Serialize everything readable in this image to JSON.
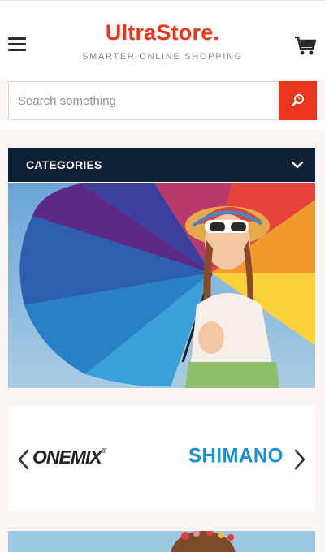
{
  "header": {
    "logo": "UltraStore.",
    "tagline": "SMARTER ONLINE SHOPPING"
  },
  "search": {
    "placeholder": "Search something"
  },
  "categories": {
    "label": "CATEGORIES"
  },
  "brands": {
    "items": [
      {
        "name": "ONEMIX",
        "mark": "®"
      },
      {
        "name": "SHIMANO"
      }
    ]
  },
  "colors": {
    "brand": "#e8361c",
    "nav": "#0d2236",
    "shimano": "#1a8fd6"
  }
}
